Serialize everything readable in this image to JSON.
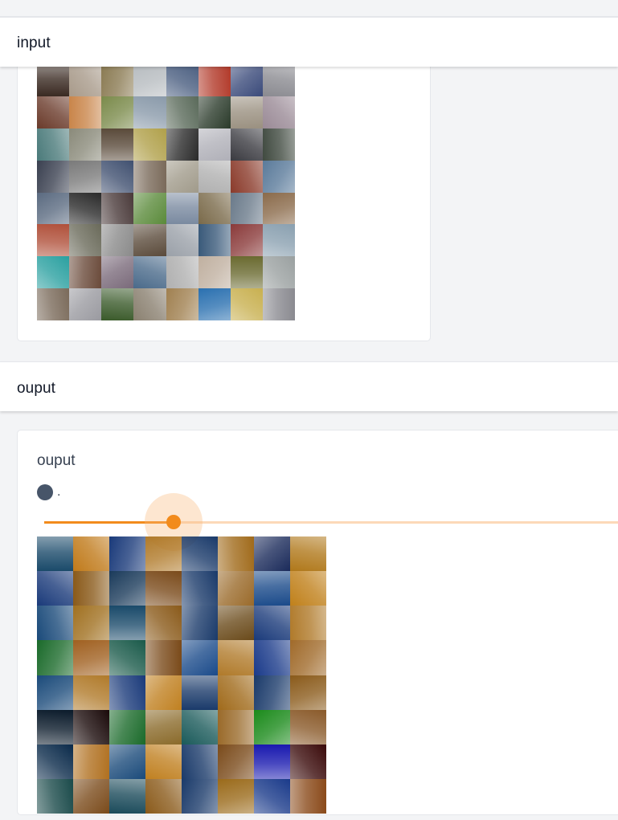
{
  "sections": {
    "input": {
      "title": "input"
    },
    "output": {
      "title": "ouput",
      "panel_label": "ouput",
      "legend_text": ".",
      "slider": {
        "value_fraction": 0.225
      }
    }
  },
  "colors": {
    "accent": "#f28b1c",
    "accent_light": "#fcd9b8",
    "legend_dot": "#475569",
    "page_bg": "#f3f4f6"
  },
  "input_grid": {
    "rows": 8,
    "cols": 8,
    "colors": [
      "#3a2a22",
      "#a89a8a",
      "#8a7a52",
      "#b7bcc0",
      "#4a5e80",
      "#b23a2a",
      "#3a4a7a",
      "#8a8a90",
      "#6a3a2a",
      "#c9854a",
      "#7a8a4a",
      "#8a9aaa",
      "#5a6a5a",
      "#2a3a2a",
      "#9a9080",
      "#9a8a96",
      "#4a7a7a",
      "#8a8a7a",
      "#5a4a3a",
      "#b0a04a",
      "#2a2a2a",
      "#b0b0b8",
      "#3a3a40",
      "#404a40",
      "#3a4050",
      "#7a7a7a",
      "#405070",
      "#7a6a5a",
      "#a09a8a",
      "#b0b0b0",
      "#8a3a2a",
      "#5a7a9a",
      "#5a6a80",
      "#2a2a2a",
      "#4a3a3a",
      "#5a8a3a",
      "#7a8aa0",
      "#7a6a4a",
      "#6a7a8a",
      "#8a6a4a",
      "#b0503a",
      "#6a6a5a",
      "#8a8a8a",
      "#5a4a3a",
      "#9aa0a8",
      "#3a5a7a",
      "#8a3a3a",
      "#8aa0b0",
      "#2aa0a0",
      "#6a4a3a",
      "#7a6a7a",
      "#4a6a8a",
      "#b0b0b0",
      "#c0b0a0",
      "#6a6a30",
      "#9aa0a0",
      "#7a6a5a",
      "#9a9aa0",
      "#3a5a2a",
      "#8a8070",
      "#a08050",
      "#2a70b0",
      "#c8b050",
      "#8a8a90"
    ]
  },
  "output_grid": {
    "rows": 8,
    "cols": 8,
    "colors": [
      "#1a4a6a",
      "#c07a1a",
      "#1a3a7a",
      "#b07a2a",
      "#1a3a6a",
      "#a06a1a",
      "#1a2a5a",
      "#b0781a",
      "#1a3a7a",
      "#8a5a1a",
      "#1a3a5a",
      "#7a4a1a",
      "#1a3a6a",
      "#9a6a2a",
      "#1a4a8a",
      "#c0801a",
      "#1a4a7a",
      "#a07020",
      "#1a4a6a",
      "#8a5a1a",
      "#1a3a6a",
      "#6a4a1a",
      "#1a3a7a",
      "#b07a2a",
      "#1a6a2a",
      "#a06020",
      "#1a5a4a",
      "#7a4a1a",
      "#1a4a8a",
      "#b07a2a",
      "#1a3a8a",
      "#a06a2a",
      "#1a4a7a",
      "#b07a2a",
      "#1a3a7a",
      "#c08020",
      "#1a3a6a",
      "#a06a1a",
      "#1a3a6a",
      "#8a5a1a",
      "#0a1a2a",
      "#1a0a0a",
      "#1a6a2a",
      "#8a6a2a",
      "#1a5a5a",
      "#9a6a2a",
      "#1a8a1a",
      "#8a5a2a",
      "#0a2a4a",
      "#b07020",
      "#1a4a7a",
      "#c08020",
      "#1a3a6a",
      "#7a4a1a",
      "#1a1ab0",
      "#3a0a0a",
      "#1a4a4a",
      "#7a4a1a",
      "#1a4a5a",
      "#8a5a1a",
      "#1a3a6a",
      "#9a6a1a",
      "#1a3a8a",
      "#8a4a1a"
    ]
  }
}
